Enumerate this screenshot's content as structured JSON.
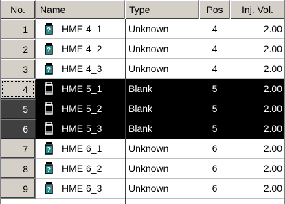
{
  "columns": {
    "no": "No.",
    "name": "Name",
    "type": "Type",
    "pos": "Pos",
    "vol": "Inj. Vol."
  },
  "rows": [
    {
      "no": "1",
      "name": "HME 4_1",
      "type": "Unknown",
      "pos": "4",
      "vol": "2.00",
      "icon": "sample-vial-icon",
      "selected": false
    },
    {
      "no": "2",
      "name": "HME 4_2",
      "type": "Unknown",
      "pos": "4",
      "vol": "2.00",
      "icon": "sample-vial-icon",
      "selected": false
    },
    {
      "no": "3",
      "name": "HME 4_3",
      "type": "Unknown",
      "pos": "4",
      "vol": "2.00",
      "icon": "sample-vial-icon",
      "selected": false
    },
    {
      "no": "4",
      "name": "HME 5_1",
      "type": "Blank",
      "pos": "5",
      "vol": "2.00",
      "icon": "blank-vial-icon",
      "selected": true
    },
    {
      "no": "5",
      "name": "HME 5_2",
      "type": "Blank",
      "pos": "5",
      "vol": "2.00",
      "icon": "blank-vial-icon",
      "selected": true
    },
    {
      "no": "6",
      "name": "HME 5_3",
      "type": "Blank",
      "pos": "5",
      "vol": "2.00",
      "icon": "blank-vial-icon",
      "selected": true
    },
    {
      "no": "7",
      "name": "HME 6_1",
      "type": "Unknown",
      "pos": "6",
      "vol": "2.00",
      "icon": "sample-vial-icon",
      "selected": false
    },
    {
      "no": "8",
      "name": "HME 6_2",
      "type": "Unknown",
      "pos": "6",
      "vol": "2.00",
      "icon": "sample-vial-icon",
      "selected": false
    },
    {
      "no": "9",
      "name": "HME 6_3",
      "type": "Unknown",
      "pos": "6",
      "vol": "2.00",
      "icon": "sample-vial-icon",
      "selected": false
    }
  ],
  "colors": {
    "selection": "#000000",
    "header": "#d4d0c8",
    "sample_icon": "#2a8a8a",
    "divider": "#3030a0"
  }
}
